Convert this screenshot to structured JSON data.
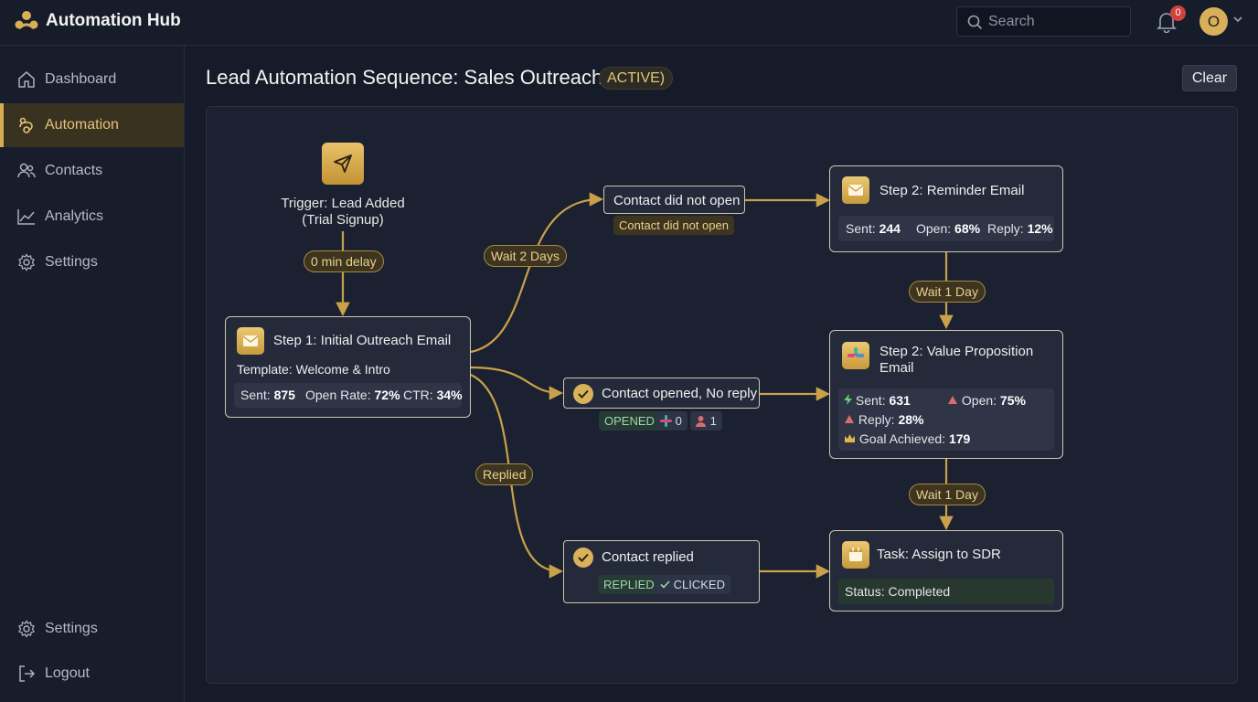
{
  "header": {
    "app_title": "Automation Hub",
    "search_placeholder": "Search",
    "notification_count": "0",
    "avatar_initial": "O"
  },
  "sidebar": {
    "items": [
      {
        "label": "Dashboard",
        "icon": "home-icon"
      },
      {
        "label": "Automation",
        "icon": "automation-icon",
        "active": true
      },
      {
        "label": "Contacts",
        "icon": "users-icon"
      },
      {
        "label": "Analytics",
        "icon": "chart-line-icon"
      },
      {
        "label": "Settings",
        "icon": "gear-icon"
      }
    ],
    "bottom_items": [
      {
        "label": "Settings",
        "icon": "gear-icon"
      },
      {
        "label": "Logout",
        "icon": "logout-icon"
      }
    ]
  },
  "page": {
    "title": "Lead Automation Sequence: Sales Outreach",
    "status": "ACTIVE)",
    "clear_label": "Clear"
  },
  "flow": {
    "trigger": {
      "line1": "Trigger: Lead Added",
      "line2": "(Trial Signup)"
    },
    "delays": {
      "initial": "0 min delay",
      "wait_2_days": "Wait 2 Days",
      "replied": "Replied",
      "wait_1_day_a": "Wait 1 Day",
      "wait_1_day_b": "Wait 1 Day"
    },
    "step1": {
      "title": "Step 1: Initial Outreach Email",
      "template": "Template: Welcome & Intro",
      "sent_label": "Sent:",
      "sent": "875",
      "open_label": "Open Rate:",
      "open": "72%",
      "ctr_label": "CTR:",
      "ctr": "34%"
    },
    "cond_not_open": {
      "label": "Contact did not open",
      "sublabel": "Contact did not open"
    },
    "cond_opened": {
      "label": "Contact opened, No reply",
      "tag": "OPENED",
      "slack_count": "0",
      "user_count": "1"
    },
    "cond_replied": {
      "label": "Contact replied",
      "tag_replied": "REPLIED",
      "tag_clicked": "CLICKED"
    },
    "step2_reminder": {
      "title": "Step 2: Reminder Email",
      "sent_label": "Sent:",
      "sent": "244",
      "open_label": "Open:",
      "open": "68%",
      "reply_label": "Reply:",
      "reply": "12%"
    },
    "step2_value": {
      "title_line1": "Step 2: Value Proposition",
      "title_line2": "Email",
      "sent_label": "Sent:",
      "sent": "631",
      "open_label": "Open:",
      "open": "75%",
      "reply_label": "Reply:",
      "reply": "28%",
      "goal_label": "Goal Achieved:",
      "goal": "179"
    },
    "task": {
      "title": "Task: Assign to SDR",
      "status": "Status: Completed"
    }
  },
  "colors": {
    "accent_gold": "#d6ac55",
    "edge": "#c9a14a",
    "success_green": "#9fd7a8",
    "badge_red": "#d0423d"
  }
}
